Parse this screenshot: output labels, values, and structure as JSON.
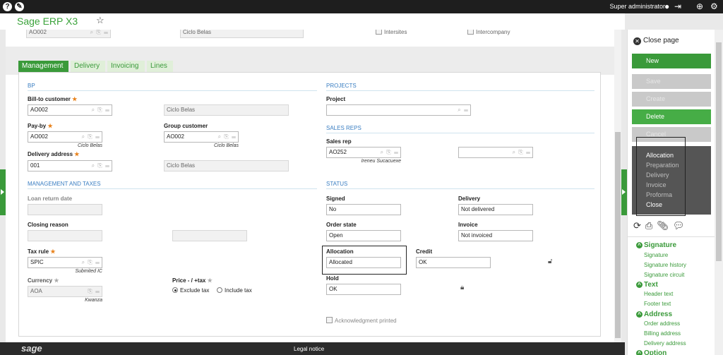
{
  "top_bar": {
    "user": "Super administrator"
  },
  "app": {
    "logo_sage": "Sage",
    "logo_product": "ERP X3"
  },
  "header_row": {
    "customer_code": "AO002",
    "customer_name": "Ciclo Belas",
    "intersites_label": "Intersites",
    "intercompany_label": "Intercompany"
  },
  "tabs": [
    {
      "label": "Management",
      "active": true
    },
    {
      "label": "Delivery",
      "active": false
    },
    {
      "label": "Invoicing",
      "active": false
    },
    {
      "label": "Lines",
      "active": false
    }
  ],
  "bp": {
    "title": "BP",
    "bill_to_label": "Bill-to customer",
    "bill_to_value": "AO002",
    "bill_to_name": "Ciclo Belas",
    "pay_by_label": "Pay-by",
    "pay_by_value": "AO002",
    "pay_by_sub": "Ciclo Belas",
    "group_label": "Group customer",
    "group_value": "AO002",
    "group_sub": "Ciclo Belas",
    "delivery_address_label": "Delivery address",
    "delivery_address_value": "001",
    "delivery_address_name": "Ciclo Belas"
  },
  "mgmt": {
    "title": "Management and taxes",
    "loan_label": "Loan return date",
    "closing_label": "Closing reason",
    "tax_rule_label": "Tax rule",
    "tax_rule_value": "SPIC",
    "tax_rule_sub": "Submited IC",
    "currency_label": "Currency",
    "currency_value": "AOA",
    "currency_sub": "Kwanza",
    "price_label": "Price - / +tax",
    "exclude_tax": "Exclude tax",
    "include_tax": "Include tax"
  },
  "projects": {
    "title": "Projects",
    "project_label": "Project"
  },
  "sales_reps": {
    "title": "Sales reps",
    "rep_label": "Sales rep",
    "rep_value": "AO252",
    "rep_sub": "Ireneu Sucacuexe"
  },
  "status": {
    "title": "Status",
    "signed_label": "Signed",
    "signed_value": "No",
    "delivery_label": "Delivery",
    "delivery_value": "Not delivered",
    "order_state_label": "Order state",
    "order_state_value": "Open",
    "invoice_label": "Invoice",
    "invoice_value": "Not invoiced",
    "allocation_label": "Allocation",
    "allocation_value": "Allocated",
    "credit_label": "Credit",
    "credit_value": "OK",
    "hold_label": "Hold",
    "hold_value": "OK",
    "ack_label": "Acknowledgment printed"
  },
  "footer": {
    "sage": "sage",
    "legal": "Legal notice"
  },
  "right_panel": {
    "close_page": "Close page",
    "buttons": [
      "New",
      "Save",
      "Create",
      "Delete",
      "Cancel"
    ],
    "menu": [
      "Allocation",
      "Preparation",
      "Delivery",
      "Invoice",
      "Proforma",
      "Close"
    ],
    "sections": [
      {
        "title": "Signature",
        "links": [
          "Signature",
          "Signature history",
          "Signature circuit"
        ]
      },
      {
        "title": "Text",
        "links": [
          "Header text",
          "Footer text"
        ]
      },
      {
        "title": "Address",
        "links": [
          "Order address",
          "Billing address",
          "Delivery address"
        ]
      },
      {
        "title": "Option",
        "links": []
      }
    ]
  },
  "colors": {
    "accent_green": "#3a9a3a",
    "section_blue": "#3a7ec2",
    "top_bar": "#1e1e1e"
  }
}
